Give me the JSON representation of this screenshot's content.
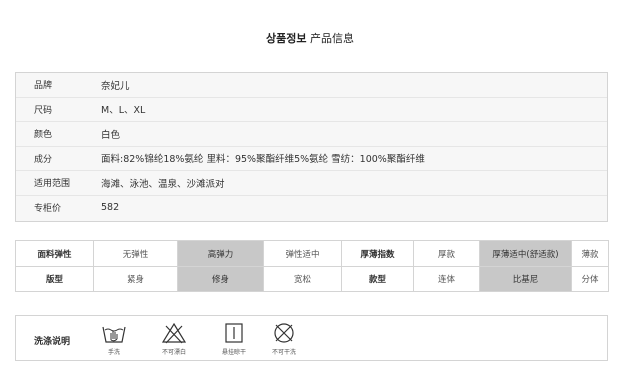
{
  "header": {
    "title_ko": "상품정보",
    "title_cn": "产品信息"
  },
  "info_rows": [
    {
      "key": "品牌",
      "value": "奈妃儿"
    },
    {
      "key": "尺码",
      "value": "M、L、XL"
    },
    {
      "key": "颜色",
      "value": "白色"
    },
    {
      "key": "成分",
      "value": "面料:82%锦纶18%氨纶 里料：95%聚酯纤维5%氨纶 雪纺：100%聚酯纤维"
    },
    {
      "key": "适用范围",
      "value": "海滩、泳池、温泉、沙滩派对"
    },
    {
      "key": "专柜价",
      "value": "582"
    }
  ],
  "attributes": {
    "row1": [
      {
        "text": "面料弹性",
        "head": true
      },
      {
        "text": "无弹性"
      },
      {
        "text": "高弹力",
        "selected": true
      },
      {
        "text": "弹性适中"
      },
      {
        "text": "厚薄指数",
        "head": true
      },
      {
        "text": "厚款"
      },
      {
        "text": "厚薄适中(舒适款)",
        "selected": true
      },
      {
        "text": "薄款"
      }
    ],
    "row2": [
      {
        "text": "版型",
        "head": true
      },
      {
        "text": "紧身"
      },
      {
        "text": "修身",
        "selected": true
      },
      {
        "text": "宽松"
      },
      {
        "text": "款型",
        "head": true
      },
      {
        "text": "连体"
      },
      {
        "text": "比基尼",
        "selected": true
      },
      {
        "text": "分体"
      }
    ]
  },
  "wash": {
    "label": "洗涤说明",
    "items": [
      {
        "icon": "hand-wash-icon",
        "caption": "手洗"
      },
      {
        "icon": "no-bleach-icon",
        "caption": "不可漂白"
      },
      {
        "icon": "hang-dry-icon",
        "caption": "悬挂晾干"
      },
      {
        "icon": "no-dry-clean-icon",
        "caption": "不可干洗"
      }
    ]
  }
}
